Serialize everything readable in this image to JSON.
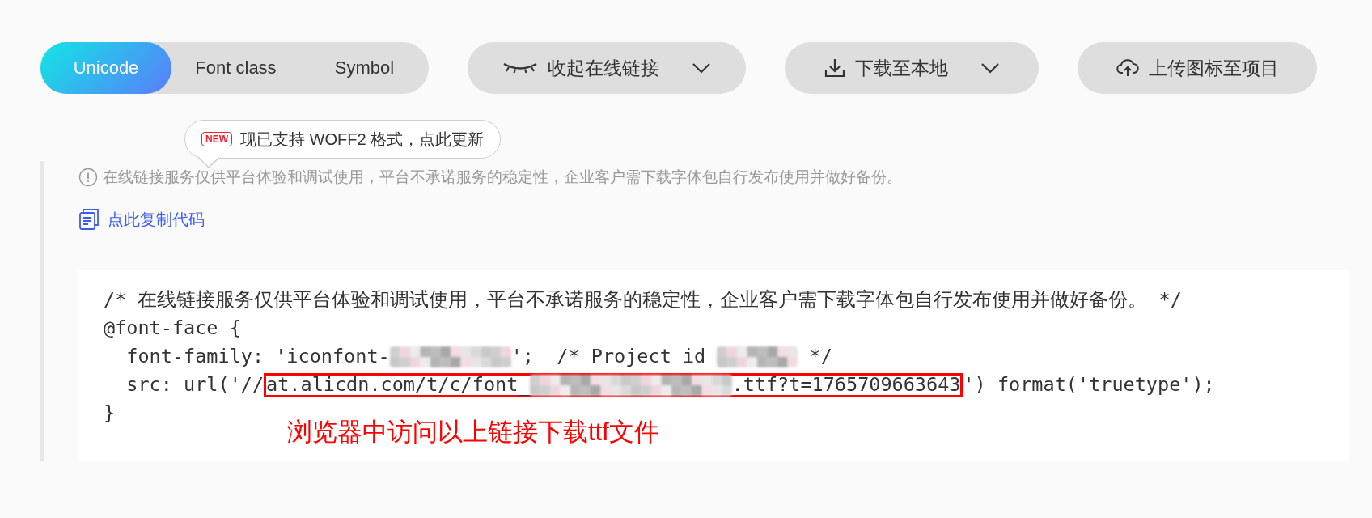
{
  "tabs": [
    {
      "label": "Unicode",
      "selected": true
    },
    {
      "label": "Font class",
      "selected": false
    },
    {
      "label": "Symbol",
      "selected": false
    }
  ],
  "actions": [
    {
      "kind": "collapse",
      "label": "收起在线链接",
      "dropdown": true
    },
    {
      "kind": "download",
      "label": "下载至本地",
      "dropdown": true
    },
    {
      "kind": "upload",
      "label": "上传图标至项目",
      "dropdown": false
    }
  ],
  "tooltip": {
    "badge": "NEW",
    "text": "现已支持 WOFF2 格式，点此更新"
  },
  "notice": "在线链接服务仅供平台体验和调试使用，平台不承诺服务的稳定性，企业客户需下载字体包自行发布使用并做好备份。",
  "copy_link": "点此复制代码",
  "code": {
    "lines": [
      {
        "segments": [
          {
            "kind": "text",
            "text": "/* 在线链接服务仅供平台体验和调试使用，平台不承诺服务的稳定性，企业客户需下载字体包自行发布使用并做好备份。 */"
          }
        ]
      },
      {
        "segments": [
          {
            "kind": "text",
            "text": "@font-face {"
          }
        ]
      },
      {
        "segments": [
          {
            "kind": "text",
            "text": "  font-family: 'iconfont-"
          },
          {
            "kind": "redacted_medium"
          },
          {
            "kind": "text",
            "text": "';  /* Project id "
          },
          {
            "kind": "redacted_small"
          },
          {
            "kind": "text",
            "text": " */"
          }
        ]
      },
      {
        "segments": [
          {
            "kind": "text",
            "text": "  src: url('//"
          },
          {
            "kind": "highlight",
            "segments": [
              {
                "kind": "text",
                "text": "at.alicdn.com/t/c/font_"
              },
              {
                "kind": "redacted_large"
              },
              {
                "kind": "text",
                "text": ".ttf?t=1765709663643"
              }
            ]
          },
          {
            "kind": "text",
            "text": "') format('truetype');"
          }
        ]
      },
      {
        "segments": [
          {
            "kind": "text",
            "text": "}"
          }
        ]
      }
    ],
    "annotation": "浏览器中访问以上链接下载ttf文件"
  }
}
